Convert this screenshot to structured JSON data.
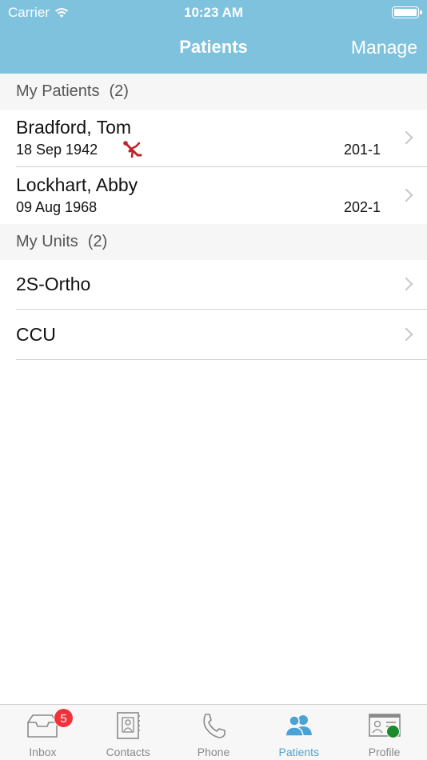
{
  "status": {
    "carrier": "Carrier",
    "time": "10:23 AM"
  },
  "nav": {
    "title": "Patients",
    "manage_label": "Manage"
  },
  "my_patients": {
    "label": "My Patients",
    "count": "(2)",
    "items": [
      {
        "name": "Bradford, Tom",
        "dob": "18 Sep 1942",
        "bed": "201-1",
        "fall_risk_icon": "fall-risk-icon"
      },
      {
        "name": "Lockhart, Abby",
        "dob": "09 Aug 1968",
        "bed": "202-1"
      }
    ]
  },
  "my_units": {
    "label": "My Units",
    "count": "(2)",
    "items": [
      {
        "name": "2S-Ortho"
      },
      {
        "name": "CCU"
      }
    ]
  },
  "tabs": [
    {
      "label": "Inbox",
      "icon": "inbox-icon",
      "badge": "5"
    },
    {
      "label": "Contacts",
      "icon": "contacts-icon"
    },
    {
      "label": "Phone",
      "icon": "phone-icon"
    },
    {
      "label": "Patients",
      "icon": "patients-icon",
      "active": true
    },
    {
      "label": "Profile",
      "icon": "profile-icon",
      "presence": "available"
    }
  ],
  "colors": {
    "accent": "#7fc2de",
    "active_tab": "#4aa3d6",
    "badge": "#f0333a",
    "fall_risk": "#c0232b",
    "presence": "#1a8a2a"
  }
}
